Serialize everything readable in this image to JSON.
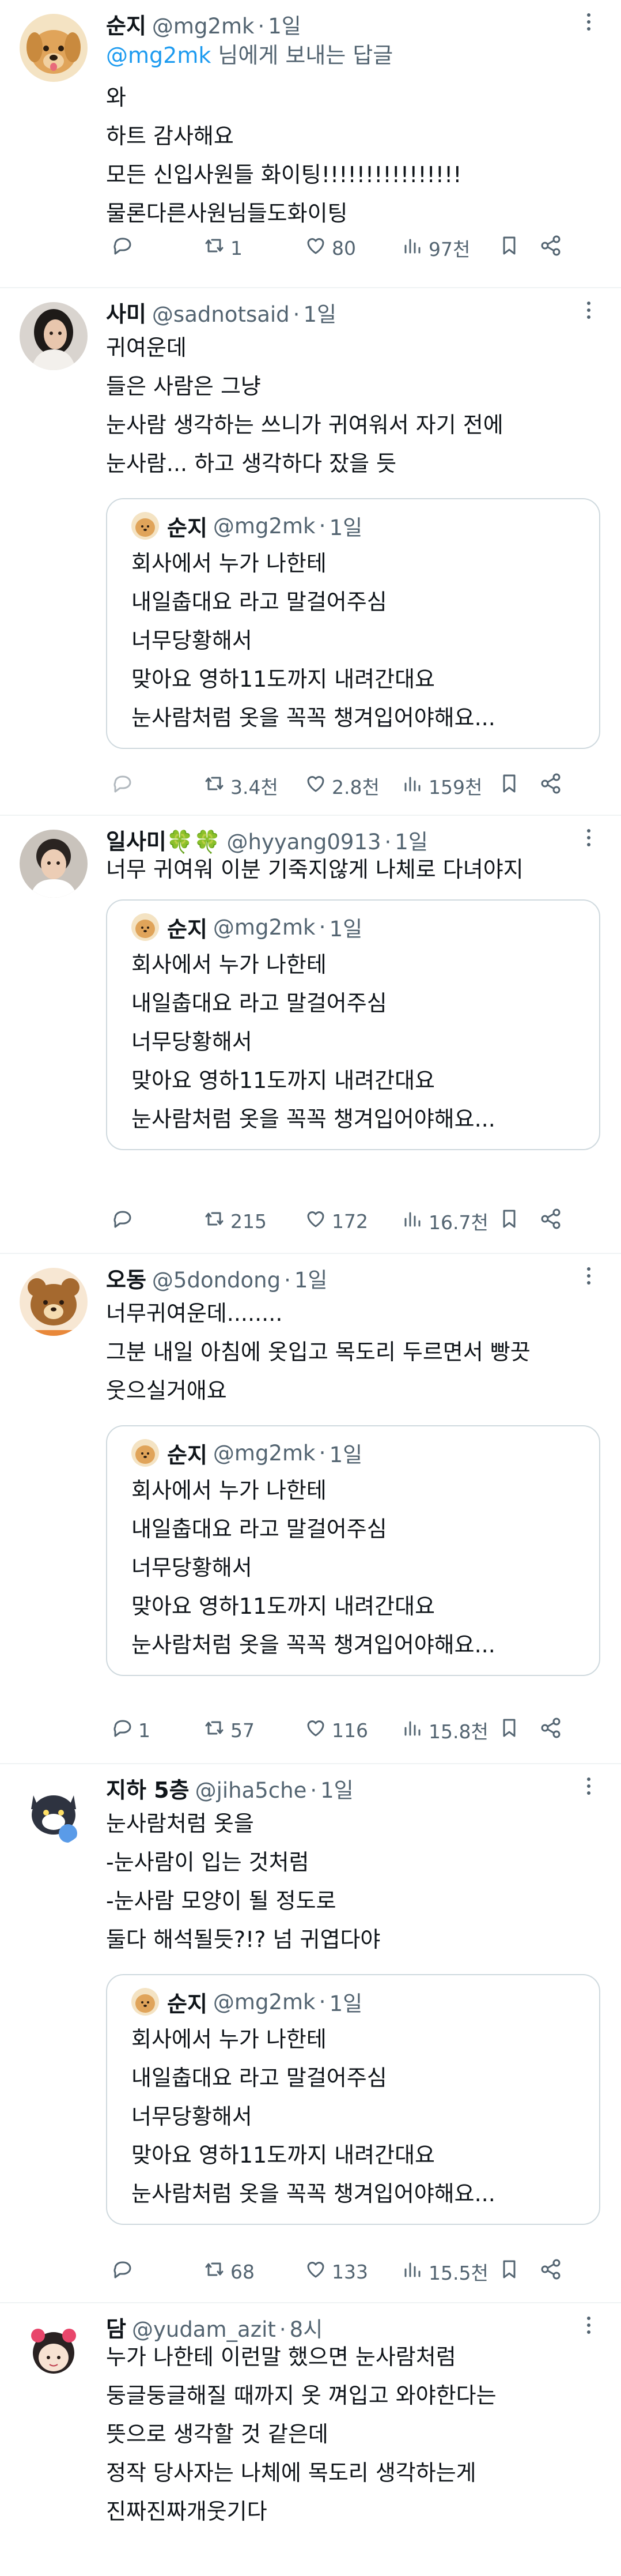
{
  "quoted": {
    "name": "순지",
    "handle": "@mg2mk",
    "time": "1일",
    "text": "회사에서 누가 나한테\n내일춥대요  라고 말걸어주심\n너무당황해서\n맞아요 영하11도까지 내려간대요\n눈사람처럼 옷을 꼭꼭 챙겨입어야해요..."
  },
  "tweets": [
    {
      "name": "순지",
      "handle": "@mg2mk",
      "time": "1일",
      "avatar": "golden-retriever-puppy",
      "replying_mention": "@mg2mk",
      "replying_suffix": " 님에게 보내는 답글",
      "text": "와\n하트 감사해요\n모든 신입사원들 화이팅!!!!!!!!!!!!!!!!\n물론다른사원님들도화이팅",
      "replies": "",
      "retweets": "1",
      "likes": "80",
      "views": "97천"
    },
    {
      "name": "사미",
      "handle": "@sadnotsaid",
      "time": "1일",
      "avatar": "person-dark-hair",
      "text": "귀여운데\n들은 사람은 그냥\n눈사람 생각하는 쓰니가 귀여워서 자기 전에\n눈사람... 하고 생각하다 잤을 듯",
      "replies": "",
      "retweets": "3.4천",
      "likes": "2.8천",
      "views": "159천"
    },
    {
      "name": "일사미🍀🍀",
      "handle": "@hyyang0913",
      "time": "1일",
      "avatar": "person-portrait",
      "text": "너무 귀여워 이분 기죽지않게 나체로 다녀야지",
      "replies": "",
      "retweets": "215",
      "likes": "172",
      "views": "16.7천"
    },
    {
      "name": "오동",
      "handle": "@5dondong",
      "time": "1일",
      "avatar": "rilakkuma-bear",
      "text": "너무귀여운데........\n그분 내일 아침에 옷입고 목도리 두르면서 빵끗\n웃으실거애요",
      "replies": "1",
      "retweets": "57",
      "likes": "116",
      "views": "15.8천"
    },
    {
      "name": "지하 5층",
      "handle": "@jiha5che",
      "time": "1일",
      "avatar": "black-cat-character",
      "text": "눈사람처럼 옷을\n-눈사람이 입는 것처럼\n-눈사람 모양이 될 정도로\n둘다 해석될듯?!? 넘 귀엽다야",
      "replies": "",
      "retweets": "68",
      "likes": "133",
      "views": "15.5천"
    },
    {
      "name": "담",
      "handle": "@yudam_azit",
      "time": "8시",
      "avatar": "cartoon-girl",
      "text": "누가 나한테 이런말 했으면 눈사람처럼\n둥글둥글해질 때까지 옷 껴입고 와야한다는\n뜻으로 생각할 것 같은데\n정작 당사자는 나체에 목도리 생각하는게\n진짜진짜개웃기다"
    }
  ]
}
